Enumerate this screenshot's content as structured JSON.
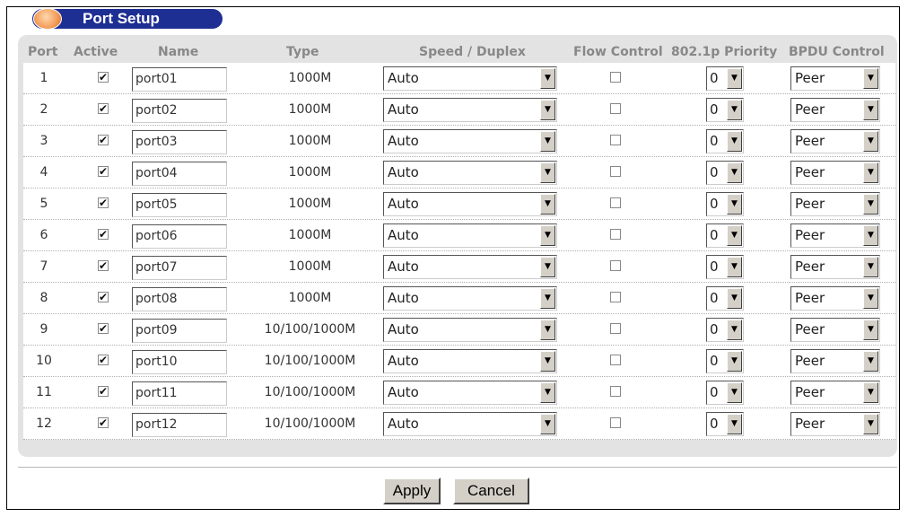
{
  "title": "Port Setup",
  "columns": {
    "port": "Port",
    "active": "Active",
    "name": "Name",
    "type": "Type",
    "speed_duplex": "Speed / Duplex",
    "flow_control": "Flow Control",
    "priority": "802.1p Priority",
    "bpdu": "BPDU Control"
  },
  "rows": [
    {
      "port": "1",
      "active": true,
      "name": "port01",
      "type": "1000M",
      "speed": "Auto",
      "flow": false,
      "priority": "0",
      "bpdu": "Peer"
    },
    {
      "port": "2",
      "active": true,
      "name": "port02",
      "type": "1000M",
      "speed": "Auto",
      "flow": false,
      "priority": "0",
      "bpdu": "Peer"
    },
    {
      "port": "3",
      "active": true,
      "name": "port03",
      "type": "1000M",
      "speed": "Auto",
      "flow": false,
      "priority": "0",
      "bpdu": "Peer"
    },
    {
      "port": "4",
      "active": true,
      "name": "port04",
      "type": "1000M",
      "speed": "Auto",
      "flow": false,
      "priority": "0",
      "bpdu": "Peer"
    },
    {
      "port": "5",
      "active": true,
      "name": "port05",
      "type": "1000M",
      "speed": "Auto",
      "flow": false,
      "priority": "0",
      "bpdu": "Peer"
    },
    {
      "port": "6",
      "active": true,
      "name": "port06",
      "type": "1000M",
      "speed": "Auto",
      "flow": false,
      "priority": "0",
      "bpdu": "Peer"
    },
    {
      "port": "7",
      "active": true,
      "name": "port07",
      "type": "1000M",
      "speed": "Auto",
      "flow": false,
      "priority": "0",
      "bpdu": "Peer"
    },
    {
      "port": "8",
      "active": true,
      "name": "port08",
      "type": "1000M",
      "speed": "Auto",
      "flow": false,
      "priority": "0",
      "bpdu": "Peer"
    },
    {
      "port": "9",
      "active": true,
      "name": "port09",
      "type": "10/100/1000M",
      "speed": "Auto",
      "flow": false,
      "priority": "0",
      "bpdu": "Peer"
    },
    {
      "port": "10",
      "active": true,
      "name": "port10",
      "type": "10/100/1000M",
      "speed": "Auto",
      "flow": false,
      "priority": "0",
      "bpdu": "Peer"
    },
    {
      "port": "11",
      "active": true,
      "name": "port11",
      "type": "10/100/1000M",
      "speed": "Auto",
      "flow": false,
      "priority": "0",
      "bpdu": "Peer"
    },
    {
      "port": "12",
      "active": true,
      "name": "port12",
      "type": "10/100/1000M",
      "speed": "Auto",
      "flow": false,
      "priority": "0",
      "bpdu": "Peer"
    }
  ],
  "buttons": {
    "apply": "Apply",
    "cancel": "Cancel"
  },
  "icons": {
    "title": "orb-icon",
    "dropdown": "dropdown-arrow-icon",
    "check": "checkmark-icon"
  },
  "colors": {
    "title_bar": "#1e2f93",
    "header_text": "#888888",
    "panel": "#e3e3e3",
    "orb": "#f4a05e"
  }
}
